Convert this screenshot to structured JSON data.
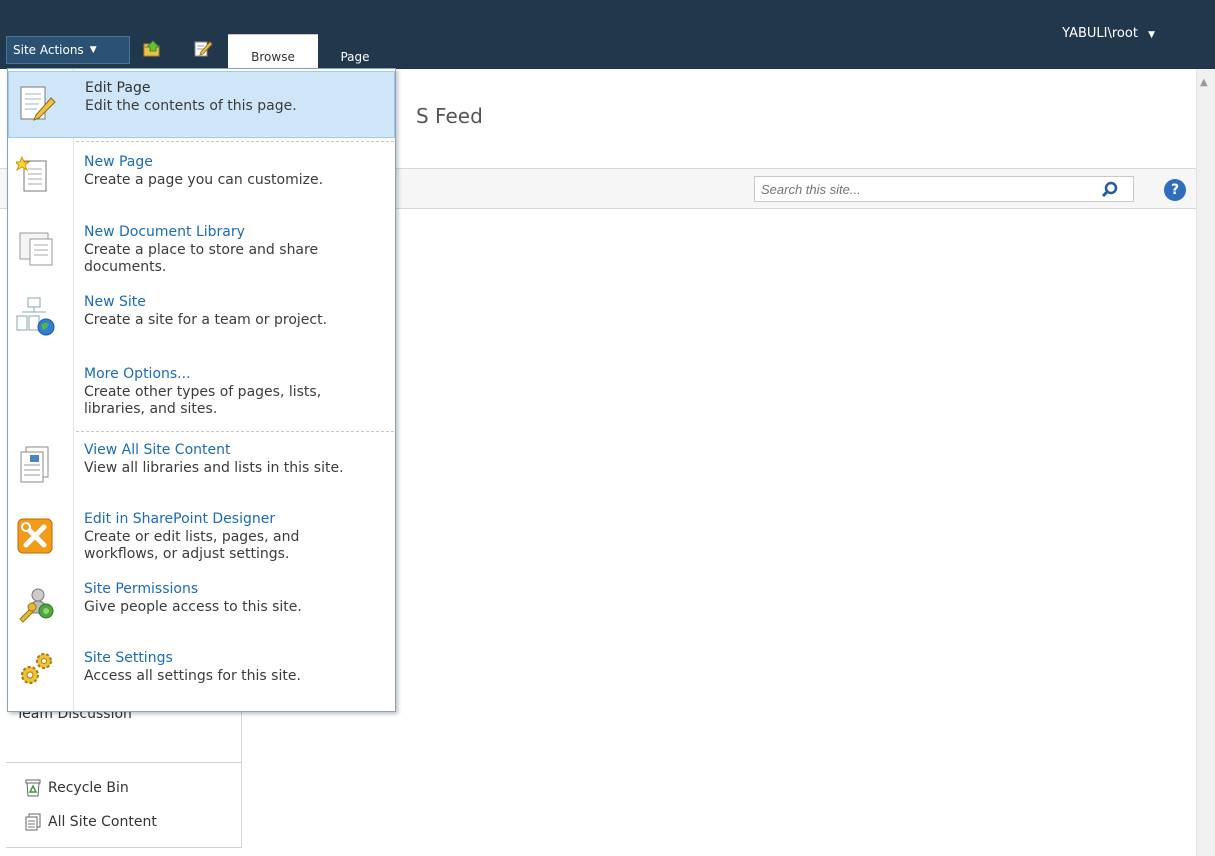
{
  "ribbon": {
    "site_actions_label": "Site Actions",
    "tabs": [
      {
        "label": "Browse"
      },
      {
        "label": "Page"
      }
    ],
    "user": "YABULI\\root"
  },
  "page": {
    "title_fragment": "S Feed"
  },
  "search": {
    "placeholder": "Search this site..."
  },
  "help": {
    "label": "?"
  },
  "leftnav": {
    "team_discussion": "Team Discussion",
    "recycle_bin": "Recycle Bin",
    "all_site_content": "All Site Content"
  },
  "menu": {
    "items": [
      {
        "title": "Edit Page",
        "desc": "Edit the contents of this page.",
        "icon": "edit-page-icon"
      },
      {
        "title": "New Page",
        "desc": "Create a page you can customize.",
        "icon": "new-page-icon"
      },
      {
        "title": "New Document Library",
        "desc": "Create a place to store and share documents.",
        "icon": "document-library-icon"
      },
      {
        "title": "New Site",
        "desc": "Create a site for a team or project.",
        "icon": "new-site-icon"
      },
      {
        "title": "More Options...",
        "desc": "Create other types of pages, lists, libraries, and sites.",
        "icon": ""
      },
      {
        "title": "View All Site Content",
        "desc": "View all libraries and lists in this site.",
        "icon": "site-content-icon"
      },
      {
        "title": "Edit in SharePoint Designer",
        "desc": "Create or edit lists, pages, and workflows, or adjust settings.",
        "icon": "sharepoint-designer-icon"
      },
      {
        "title": "Site Permissions",
        "desc": "Give people access to this site.",
        "icon": "permissions-icon"
      },
      {
        "title": "Site Settings",
        "desc": "Access all settings for this site.",
        "icon": "settings-gear-icon"
      }
    ]
  }
}
